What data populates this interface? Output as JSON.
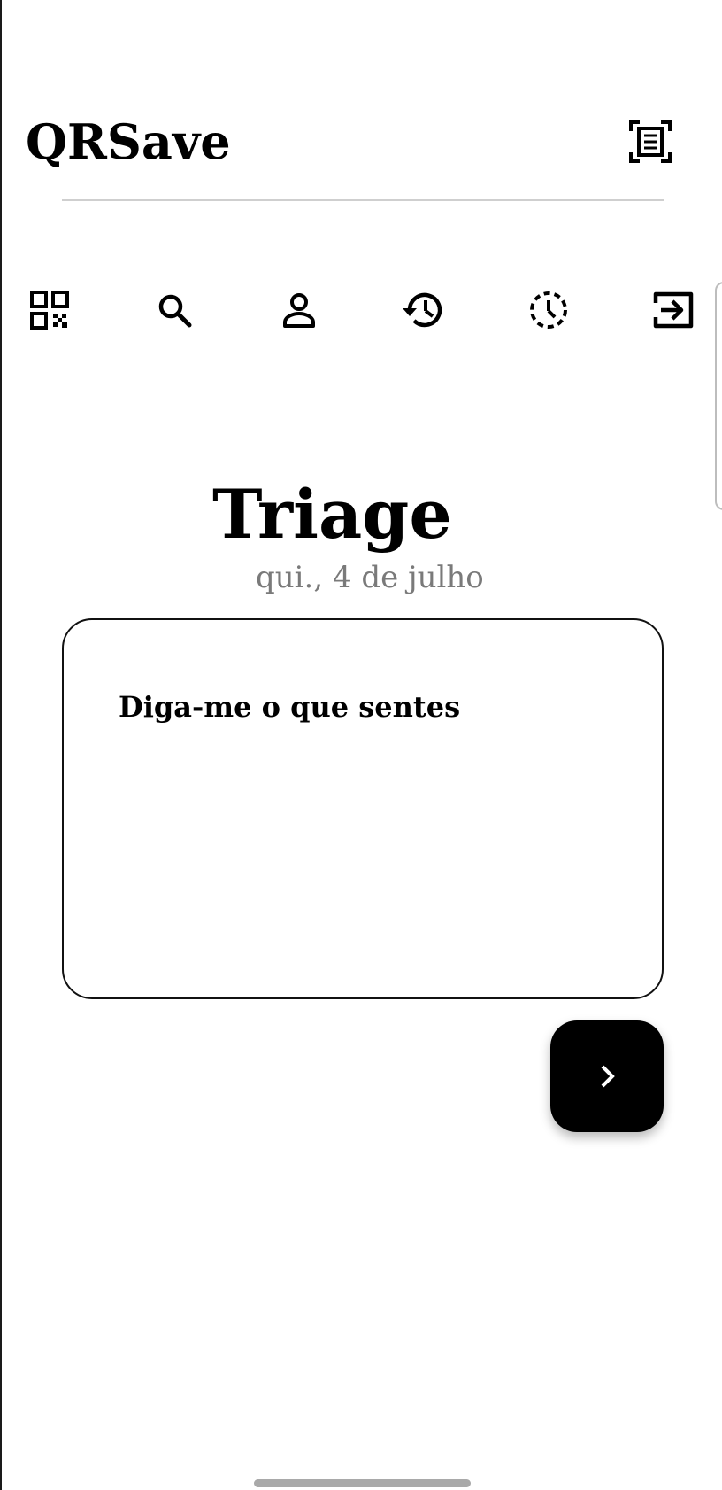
{
  "app": {
    "title": "QRSave"
  },
  "header": {
    "scan_icon": "document-scanner-icon"
  },
  "nav": {
    "items": [
      {
        "icon": "qr-code-icon"
      },
      {
        "icon": "search-icon"
      },
      {
        "icon": "person-icon"
      },
      {
        "icon": "history-icon"
      },
      {
        "icon": "pending-clock-icon"
      },
      {
        "icon": "logout-icon"
      }
    ]
  },
  "main": {
    "title": "Triage",
    "date": "qui., 4 de julho",
    "symptom_input": {
      "placeholder": "Diga-me o que sentes",
      "value": ""
    },
    "next_button_icon": "chevron-right-icon"
  },
  "colors": {
    "primary": "#000000",
    "background": "#ffffff",
    "muted_text": "#7a7a7a",
    "divider": "#cfcfcf"
  }
}
